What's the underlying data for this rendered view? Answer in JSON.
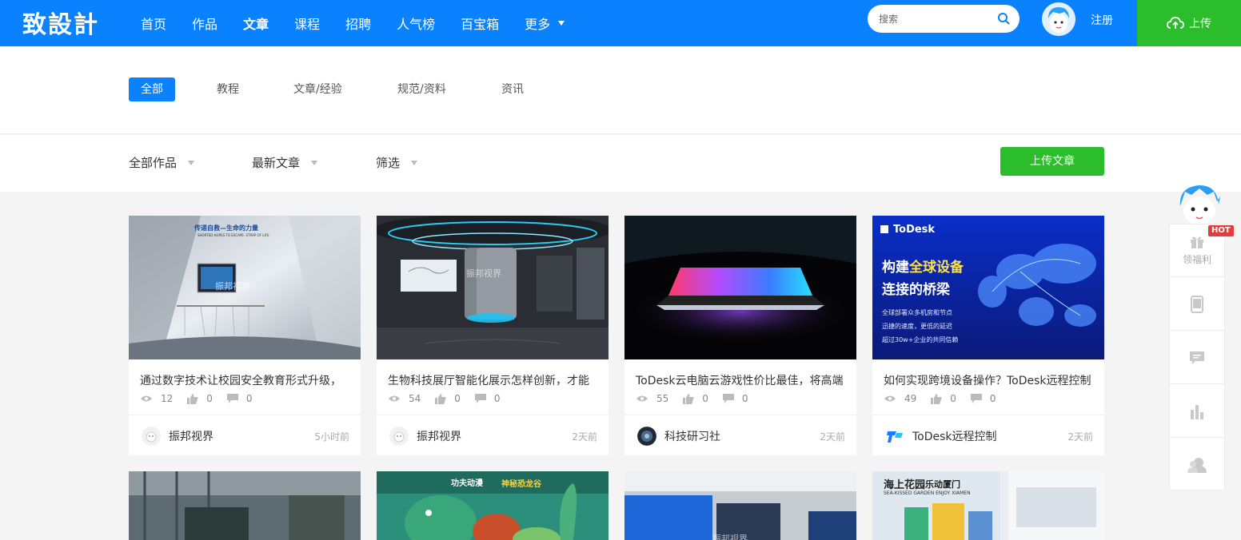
{
  "header": {
    "logo": "致設計",
    "nav": [
      "首页",
      "作品",
      "文章",
      "课程",
      "招聘",
      "人气榜",
      "百宝箱",
      "更多"
    ],
    "search_placeholder": "搜索",
    "register": "注册",
    "upload": "上传"
  },
  "categories": [
    "全部",
    "教程",
    "文章/经验",
    "规范/资料",
    "资讯"
  ],
  "filters": [
    "全部作品",
    "最新文章",
    "筛选"
  ],
  "upload_article": "上传文章",
  "cards": [
    {
      "title": "通过数字技术让校园安全教育形式升级，",
      "views": "12",
      "likes": "0",
      "comments": "0",
      "author": "振邦视界",
      "time": "5小时前"
    },
    {
      "title": "生物科技展厅智能化展示怎样创新，才能",
      "views": "54",
      "likes": "0",
      "comments": "0",
      "author": "振邦视界",
      "time": "2天前"
    },
    {
      "title": "ToDesk云电脑云游戏性价比最佳，将高端",
      "views": "55",
      "likes": "0",
      "comments": "0",
      "author": "科技研习社",
      "time": "2天前"
    },
    {
      "title": "如何实现跨境设备操作？ToDesk远程控制",
      "views": "49",
      "likes": "0",
      "comments": "0",
      "author": "ToDesk远程控制",
      "time": "2天前"
    }
  ],
  "thumb_text": {
    "card1_banner": "传递自救—生命的力量",
    "card1_sub": "SHORTED HOPES TO ESCAPE- STRAP OF LIFE",
    "watermark": "振邦视界",
    "todesk_brand": "ToDesk",
    "todesk_headline_a": "构建",
    "todesk_headline_b": "全球设备",
    "todesk_headline_c": "连接的桥梁",
    "todesk_bullet1": "全球部署众多机房和节点",
    "todesk_bullet2": "迅捷的速度，更低的延迟",
    "todesk_bullet3": "超过30w+企业的共同信赖",
    "row2_kungfu": "功夫动漫",
    "row2_dino": "神秘恐龙谷",
    "row2_garden": "海上花园",
    "row2_garden2": "乐动厦门",
    "row2_garden_en": "SEA-KISSED GARDEN ENJOY XIAMEN"
  },
  "float_bar": {
    "hot": "HOT",
    "welfare": "领福利"
  },
  "colors": {
    "primary": "#0a82ff",
    "green": "#2bbd2b",
    "hot": "#e53b3b"
  }
}
